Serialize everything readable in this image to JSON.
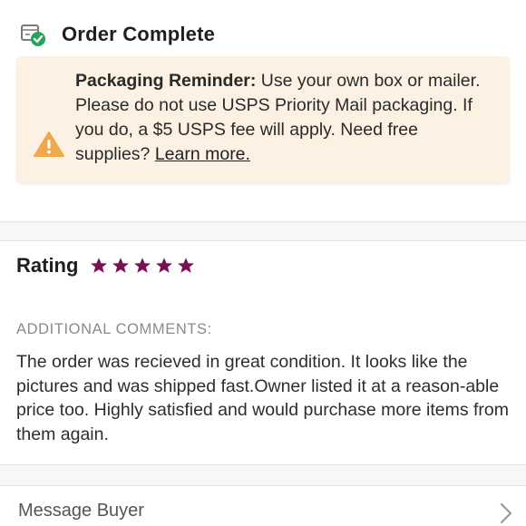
{
  "order_status": {
    "title": "Order Complete",
    "icon": "box-check-icon"
  },
  "packaging_notice": {
    "icon": "warning-icon",
    "heading": "Packaging Reminder:",
    "body": " Use your own box or mailer. Please do not use USPS Priority Mail packaging. If you do, a $5 USPS fee will apply. Need free supplies? ",
    "link_label": "Learn more.",
    "background": "#fdf1e3",
    "icon_color": "#f0a94a"
  },
  "rating": {
    "label": "Rating",
    "stars": 5,
    "max_stars": 5,
    "star_color": "#7b0f52"
  },
  "comments": {
    "heading": "ADDITIONAL COMMENTS:",
    "text": "The order was recieved in great condition. It looks like the pictures and was shipped fast.Owner listed it at a reason-able price too. Highly satisfied and would purchase more items from them again."
  },
  "message_buyer": {
    "label": "Message Buyer",
    "icon": "chevron-right-icon"
  }
}
